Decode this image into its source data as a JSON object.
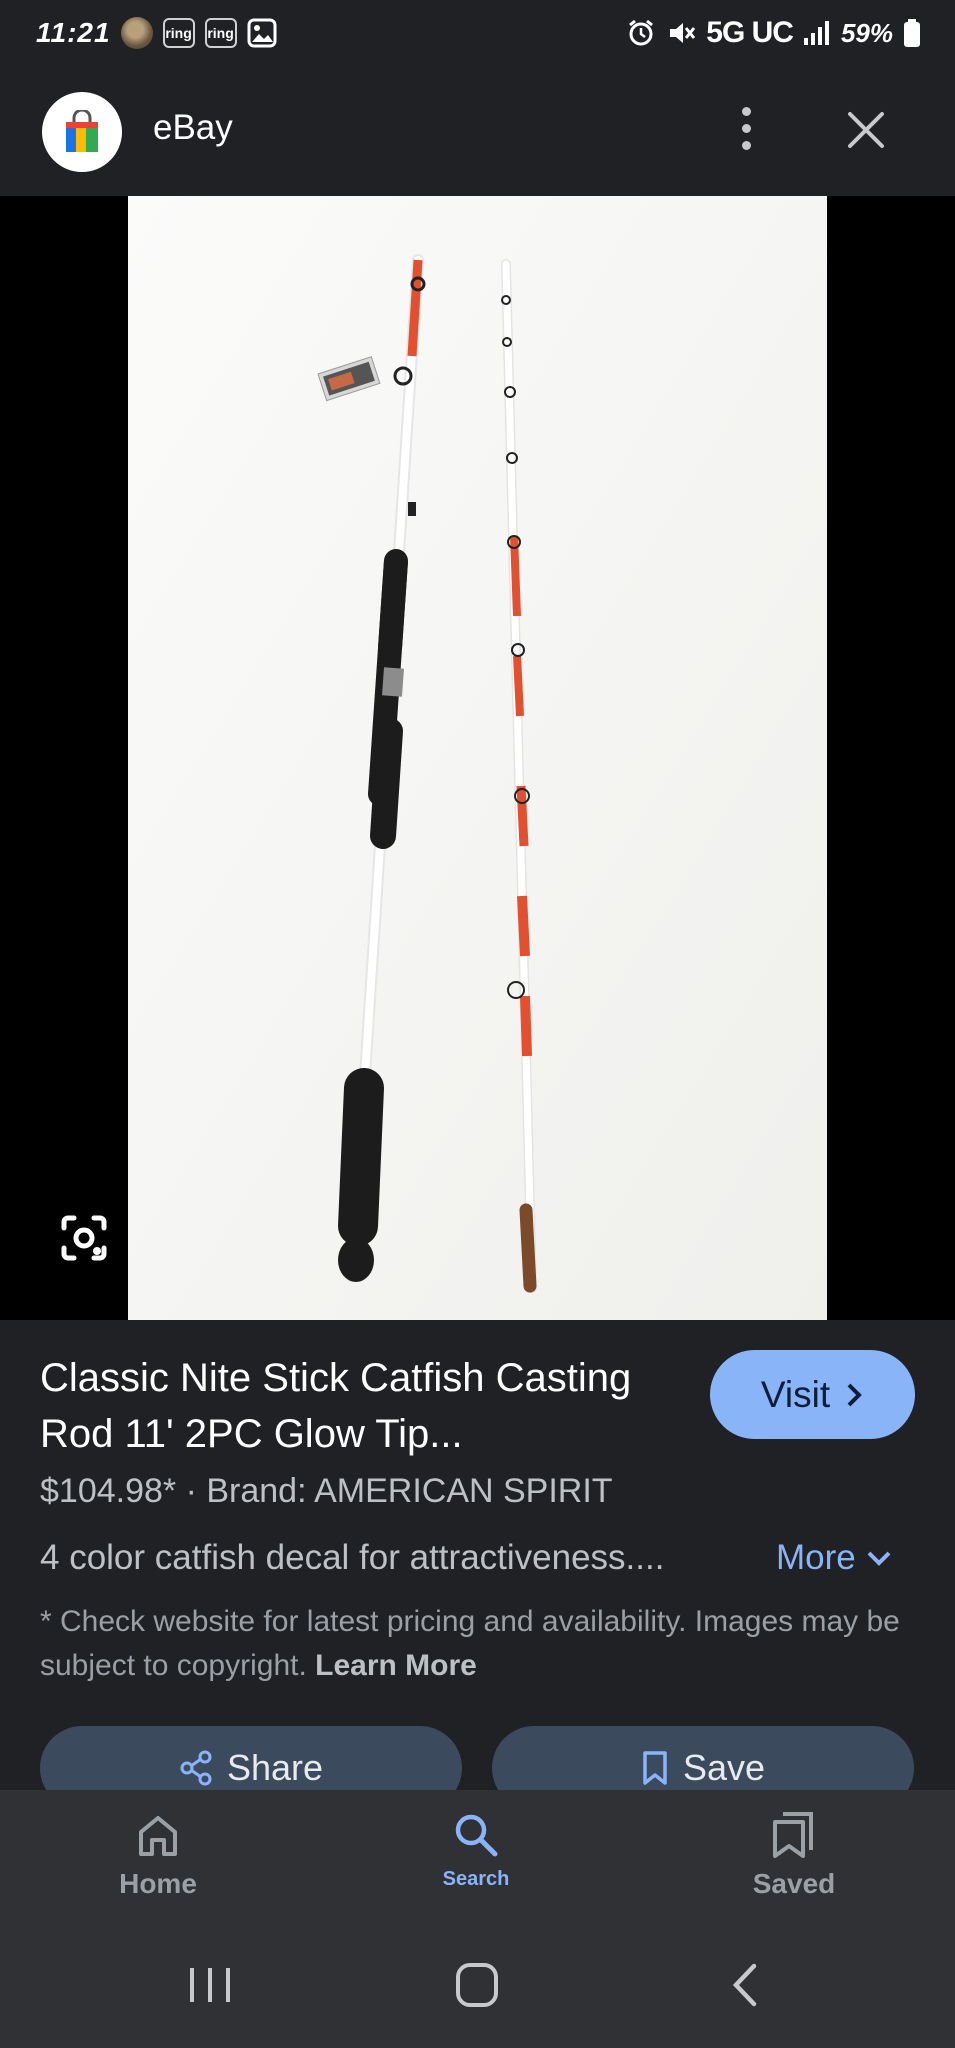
{
  "status_bar": {
    "time": "11:21",
    "ring_badges": [
      "ring",
      "ring"
    ],
    "network": "5G UC",
    "battery": "59%"
  },
  "header": {
    "app_title": "eBay",
    "icons": [
      "shopping-bag-logo",
      "more-vert-icon",
      "close-icon"
    ]
  },
  "product": {
    "title": "Classic Nite Stick Catfish Casting Rod 11' 2PC Glow Tip...",
    "visit_label": "Visit",
    "price_line": "$104.98* · Brand: AMERICAN SPIRIT",
    "description": "4 color catfish decal for attractiveness....",
    "more_label": "More",
    "disclaimer": "* Check website for latest pricing and availability. Images may be subject to copyright.",
    "learn_more": "Learn More",
    "share_label": "Share",
    "save_label": "Save"
  },
  "bottom_nav": {
    "items": [
      {
        "label": "Home",
        "icon": "home-icon"
      },
      {
        "label": "Search",
        "icon": "search-icon",
        "active": true
      },
      {
        "label": "Saved",
        "icon": "saved-icon"
      }
    ]
  },
  "colors": {
    "accent": "#8ab4f8",
    "background": "#202124",
    "button": "#3c4a5e"
  }
}
